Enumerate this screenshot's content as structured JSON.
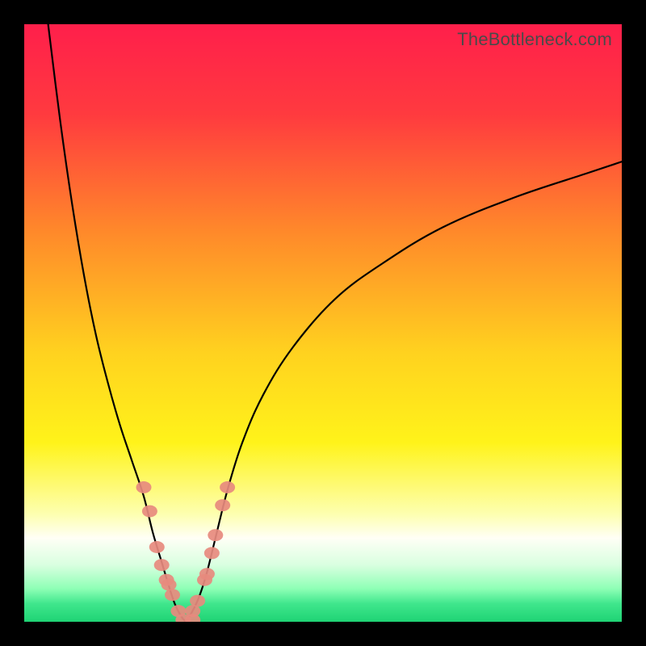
{
  "watermark": {
    "text": "TheBottleneck.com"
  },
  "colors": {
    "black": "#000000",
    "marker": "#e78a7e",
    "gradient_stops": [
      {
        "offset": 0.0,
        "color": "#ff1f4b"
      },
      {
        "offset": 0.15,
        "color": "#ff3a3f"
      },
      {
        "offset": 0.35,
        "color": "#ff8a2a"
      },
      {
        "offset": 0.55,
        "color": "#ffd21f"
      },
      {
        "offset": 0.7,
        "color": "#fff31a"
      },
      {
        "offset": 0.82,
        "color": "#fdffb0"
      },
      {
        "offset": 0.86,
        "color": "#fffff6"
      },
      {
        "offset": 0.905,
        "color": "#d9ffe0"
      },
      {
        "offset": 0.945,
        "color": "#8dffb5"
      },
      {
        "offset": 0.97,
        "color": "#3fe68c"
      },
      {
        "offset": 1.0,
        "color": "#1fd374"
      }
    ]
  },
  "chart_data": {
    "type": "line",
    "title": "",
    "xlabel": "",
    "ylabel": "",
    "xlim": [
      0,
      100
    ],
    "ylim": [
      0,
      100
    ],
    "notch_x": 27,
    "series": [
      {
        "name": "left-branch",
        "x": [
          4,
          6,
          8,
          10,
          12,
          14,
          16,
          18,
          20,
          21.5,
          23,
          24.2,
          25.2,
          26.2,
          27
        ],
        "y": [
          100,
          84,
          70,
          58,
          48,
          40,
          33,
          27,
          21,
          15,
          10,
          6,
          3,
          1,
          0
        ]
      },
      {
        "name": "right-branch",
        "x": [
          27,
          28,
          29.2,
          30.5,
          32,
          34,
          36.5,
          40,
          45,
          52,
          60,
          70,
          82,
          94,
          100
        ],
        "y": [
          0,
          1.5,
          4,
          8,
          14,
          22,
          30,
          38,
          46,
          54,
          60,
          66,
          71,
          75,
          77
        ]
      }
    ],
    "markers": {
      "name": "highlighted-points",
      "points": [
        {
          "x": 20.0,
          "y": 22.5
        },
        {
          "x": 21.0,
          "y": 18.5
        },
        {
          "x": 22.2,
          "y": 12.5
        },
        {
          "x": 23.0,
          "y": 9.5
        },
        {
          "x": 23.8,
          "y": 7.0
        },
        {
          "x": 24.2,
          "y": 6.2
        },
        {
          "x": 24.8,
          "y": 4.5
        },
        {
          "x": 25.8,
          "y": 1.8
        },
        {
          "x": 26.6,
          "y": 0.3
        },
        {
          "x": 28.2,
          "y": 0.3
        },
        {
          "x": 28.2,
          "y": 1.8
        },
        {
          "x": 29.0,
          "y": 3.5
        },
        {
          "x": 30.2,
          "y": 7.0
        },
        {
          "x": 30.6,
          "y": 8.0
        },
        {
          "x": 31.4,
          "y": 11.5
        },
        {
          "x": 32.0,
          "y": 14.5
        },
        {
          "x": 33.2,
          "y": 19.5
        },
        {
          "x": 34.0,
          "y": 22.5
        }
      ]
    }
  }
}
